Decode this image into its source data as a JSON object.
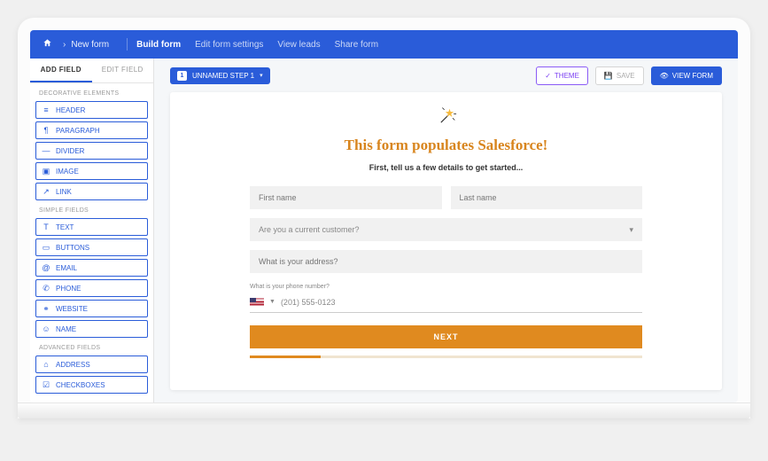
{
  "breadcrumb": {
    "current": "New form"
  },
  "nav": {
    "build": "Build form",
    "edit": "Edit form settings",
    "leads": "View leads",
    "share": "Share form"
  },
  "sidebarTabs": {
    "add": "ADD FIELD",
    "edit": "EDIT FIELD"
  },
  "groups": {
    "decorative": "DECORATIVE ELEMENTS",
    "simple": "SIMPLE FIELDS",
    "advanced": "ADVANCED FIELDS"
  },
  "fields": {
    "header": "HEADER",
    "paragraph": "PARAGRAPH",
    "divider": "DIVIDER",
    "image": "IMAGE",
    "link": "LINK",
    "text": "TEXT",
    "buttons": "BUTTONS",
    "email": "EMAIL",
    "phone": "PHONE",
    "website": "WEBSITE",
    "name": "NAME",
    "address": "ADDRESS",
    "checkboxes": "CHECKBOXES"
  },
  "step": {
    "num": "1",
    "label": "UNNAMED STEP 1"
  },
  "toolbar": {
    "theme": "THEME",
    "save": "SAVE",
    "view": "VIEW FORM"
  },
  "form": {
    "title": "This form populates Salesforce!",
    "subtitle": "First, tell us a few details to get started...",
    "first": "First name",
    "last": "Last name",
    "customer": "Are you a current customer?",
    "address": "What is your address?",
    "phoneLabel": "What is your phone number?",
    "phonePh": "(201) 555-0123",
    "next": "NEXT"
  }
}
